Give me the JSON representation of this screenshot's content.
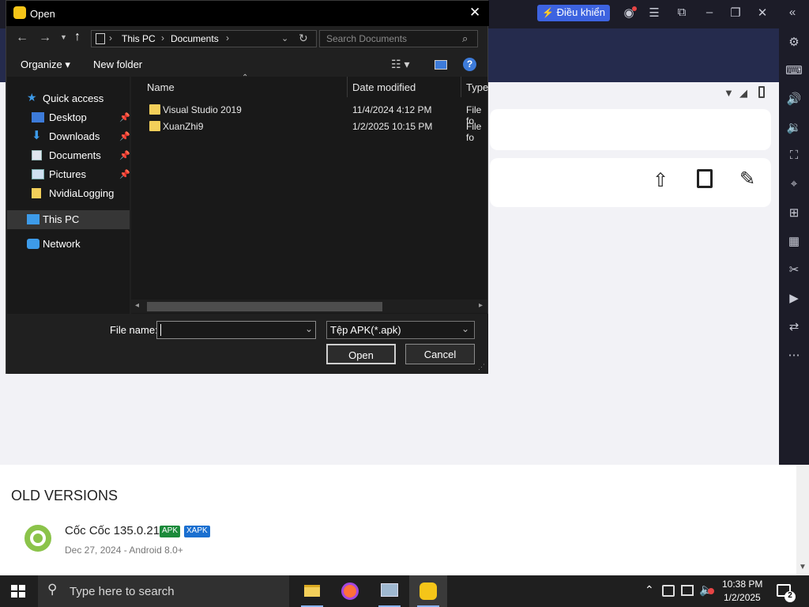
{
  "colors": {
    "accent": "#3d7bd9",
    "emulator_dark": "#1c1c28",
    "banner": "#252b4d",
    "badge_apk": "#1b8a3a",
    "badge_xapk": "#1a6fd0",
    "folder": "#f3cf5a"
  },
  "dialog": {
    "title": "Open",
    "address": {
      "segments": [
        "This PC",
        "Documents"
      ],
      "separator": "›"
    },
    "search_placeholder": "Search Documents",
    "toolbar": {
      "organize": "Organize ▾",
      "new_folder": "New folder"
    },
    "nav": [
      {
        "label": "Quick access",
        "icon": "star-icon",
        "pinned": false
      },
      {
        "label": "Desktop",
        "icon": "desktop-icon",
        "pinned": true
      },
      {
        "label": "Downloads",
        "icon": "download-icon",
        "pinned": true
      },
      {
        "label": "Documents",
        "icon": "documents-icon",
        "pinned": true
      },
      {
        "label": "Pictures",
        "icon": "pictures-icon",
        "pinned": true
      },
      {
        "label": "NvidiaLogging",
        "icon": "folder-icon",
        "pinned": false
      },
      {
        "label": "This PC",
        "icon": "computer-icon",
        "pinned": false,
        "selected": true
      },
      {
        "label": "Network",
        "icon": "network-icon",
        "pinned": false
      }
    ],
    "columns": [
      "Name",
      "Date modified",
      "Type"
    ],
    "files": [
      {
        "name": "Visual Studio 2019",
        "date": "11/4/2024 4:12 PM",
        "type": "File fo"
      },
      {
        "name": "XuanZhi9",
        "date": "1/2/2025 10:15 PM",
        "type": "File fo"
      }
    ],
    "filename_label": "File name:",
    "filename_value": "",
    "filter": "Tệp APK(*.apk)",
    "open_button": "Open",
    "cancel_button": "Cancel"
  },
  "emulator": {
    "control_button": "Điều khiển",
    "sidebar_icons": [
      "gear-icon",
      "keyboard-icon",
      "volume-up-icon",
      "volume-down-icon",
      "screenshot-icon",
      "location-icon",
      "add-window-icon",
      "install-apk-icon",
      "cut-icon",
      "video-record-icon",
      "sync-icon",
      "more-icon"
    ]
  },
  "page": {
    "section_title": "OLD VERSIONS",
    "app_name": "Cốc Cốc 135.0.215",
    "badge_apk": "APK",
    "badge_xapk": "XAPK",
    "app_meta": "Dec 27, 2024 - Android 8.0+"
  },
  "taskbar": {
    "search_placeholder": "Type here to search",
    "time": "10:38 PM",
    "date": "1/2/2025",
    "notification_count": "2"
  }
}
